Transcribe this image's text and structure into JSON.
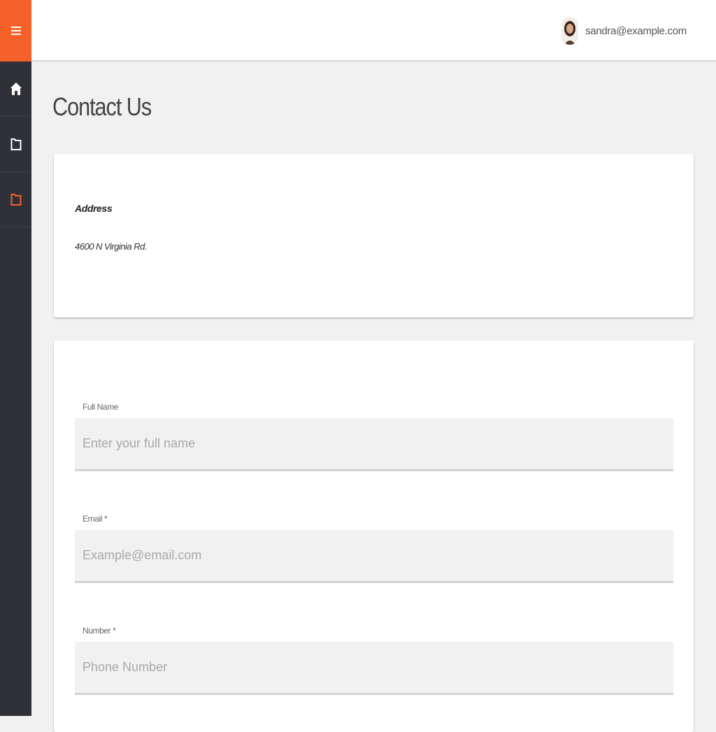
{
  "sidebar": {
    "menu_icon": "hamburger-menu-icon",
    "items": [
      {
        "name": "home",
        "icon": "home-icon"
      },
      {
        "name": "documents",
        "icon": "folder-icon"
      },
      {
        "name": "contact",
        "icon": "folder-icon",
        "active": true
      }
    ],
    "colors": {
      "menu_bg": "#f4622a",
      "sidebar_bg": "#2f3038",
      "active_icon": "#f4622a"
    }
  },
  "header": {
    "user_email": "sandra@example.com"
  },
  "page": {
    "title": "Contact Us"
  },
  "address": {
    "label": "Address",
    "value": "4600 N Virginia Rd."
  },
  "form": {
    "fields": [
      {
        "label": "Full Name",
        "placeholder": "Enter your full name",
        "value": ""
      },
      {
        "label": "Email *",
        "placeholder": "Example@email.com",
        "value": ""
      },
      {
        "label": "Number *",
        "placeholder": "Phone Number",
        "value": ""
      }
    ]
  }
}
